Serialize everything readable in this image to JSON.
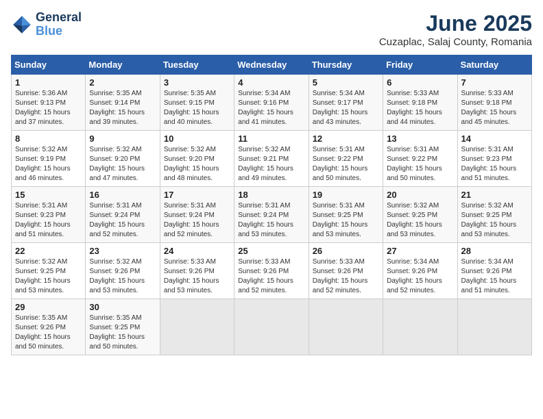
{
  "logo": {
    "line1": "General",
    "line2": "Blue"
  },
  "title": "June 2025",
  "subtitle": "Cuzaplac, Salaj County, Romania",
  "weekdays": [
    "Sunday",
    "Monday",
    "Tuesday",
    "Wednesday",
    "Thursday",
    "Friday",
    "Saturday"
  ],
  "weeks": [
    [
      {
        "day": "1",
        "info": "Sunrise: 5:36 AM\nSunset: 9:13 PM\nDaylight: 15 hours\nand 37 minutes."
      },
      {
        "day": "2",
        "info": "Sunrise: 5:35 AM\nSunset: 9:14 PM\nDaylight: 15 hours\nand 39 minutes."
      },
      {
        "day": "3",
        "info": "Sunrise: 5:35 AM\nSunset: 9:15 PM\nDaylight: 15 hours\nand 40 minutes."
      },
      {
        "day": "4",
        "info": "Sunrise: 5:34 AM\nSunset: 9:16 PM\nDaylight: 15 hours\nand 41 minutes."
      },
      {
        "day": "5",
        "info": "Sunrise: 5:34 AM\nSunset: 9:17 PM\nDaylight: 15 hours\nand 43 minutes."
      },
      {
        "day": "6",
        "info": "Sunrise: 5:33 AM\nSunset: 9:18 PM\nDaylight: 15 hours\nand 44 minutes."
      },
      {
        "day": "7",
        "info": "Sunrise: 5:33 AM\nSunset: 9:18 PM\nDaylight: 15 hours\nand 45 minutes."
      }
    ],
    [
      {
        "day": "8",
        "info": "Sunrise: 5:32 AM\nSunset: 9:19 PM\nDaylight: 15 hours\nand 46 minutes."
      },
      {
        "day": "9",
        "info": "Sunrise: 5:32 AM\nSunset: 9:20 PM\nDaylight: 15 hours\nand 47 minutes."
      },
      {
        "day": "10",
        "info": "Sunrise: 5:32 AM\nSunset: 9:20 PM\nDaylight: 15 hours\nand 48 minutes."
      },
      {
        "day": "11",
        "info": "Sunrise: 5:32 AM\nSunset: 9:21 PM\nDaylight: 15 hours\nand 49 minutes."
      },
      {
        "day": "12",
        "info": "Sunrise: 5:31 AM\nSunset: 9:22 PM\nDaylight: 15 hours\nand 50 minutes."
      },
      {
        "day": "13",
        "info": "Sunrise: 5:31 AM\nSunset: 9:22 PM\nDaylight: 15 hours\nand 50 minutes."
      },
      {
        "day": "14",
        "info": "Sunrise: 5:31 AM\nSunset: 9:23 PM\nDaylight: 15 hours\nand 51 minutes."
      }
    ],
    [
      {
        "day": "15",
        "info": "Sunrise: 5:31 AM\nSunset: 9:23 PM\nDaylight: 15 hours\nand 51 minutes."
      },
      {
        "day": "16",
        "info": "Sunrise: 5:31 AM\nSunset: 9:24 PM\nDaylight: 15 hours\nand 52 minutes."
      },
      {
        "day": "17",
        "info": "Sunrise: 5:31 AM\nSunset: 9:24 PM\nDaylight: 15 hours\nand 52 minutes."
      },
      {
        "day": "18",
        "info": "Sunrise: 5:31 AM\nSunset: 9:24 PM\nDaylight: 15 hours\nand 53 minutes."
      },
      {
        "day": "19",
        "info": "Sunrise: 5:31 AM\nSunset: 9:25 PM\nDaylight: 15 hours\nand 53 minutes."
      },
      {
        "day": "20",
        "info": "Sunrise: 5:32 AM\nSunset: 9:25 PM\nDaylight: 15 hours\nand 53 minutes."
      },
      {
        "day": "21",
        "info": "Sunrise: 5:32 AM\nSunset: 9:25 PM\nDaylight: 15 hours\nand 53 minutes."
      }
    ],
    [
      {
        "day": "22",
        "info": "Sunrise: 5:32 AM\nSunset: 9:25 PM\nDaylight: 15 hours\nand 53 minutes."
      },
      {
        "day": "23",
        "info": "Sunrise: 5:32 AM\nSunset: 9:26 PM\nDaylight: 15 hours\nand 53 minutes."
      },
      {
        "day": "24",
        "info": "Sunrise: 5:33 AM\nSunset: 9:26 PM\nDaylight: 15 hours\nand 53 minutes."
      },
      {
        "day": "25",
        "info": "Sunrise: 5:33 AM\nSunset: 9:26 PM\nDaylight: 15 hours\nand 52 minutes."
      },
      {
        "day": "26",
        "info": "Sunrise: 5:33 AM\nSunset: 9:26 PM\nDaylight: 15 hours\nand 52 minutes."
      },
      {
        "day": "27",
        "info": "Sunrise: 5:34 AM\nSunset: 9:26 PM\nDaylight: 15 hours\nand 52 minutes."
      },
      {
        "day": "28",
        "info": "Sunrise: 5:34 AM\nSunset: 9:26 PM\nDaylight: 15 hours\nand 51 minutes."
      }
    ],
    [
      {
        "day": "29",
        "info": "Sunrise: 5:35 AM\nSunset: 9:26 PM\nDaylight: 15 hours\nand 50 minutes."
      },
      {
        "day": "30",
        "info": "Sunrise: 5:35 AM\nSunset: 9:25 PM\nDaylight: 15 hours\nand 50 minutes."
      },
      {
        "day": "",
        "info": ""
      },
      {
        "day": "",
        "info": ""
      },
      {
        "day": "",
        "info": ""
      },
      {
        "day": "",
        "info": ""
      },
      {
        "day": "",
        "info": ""
      }
    ]
  ]
}
